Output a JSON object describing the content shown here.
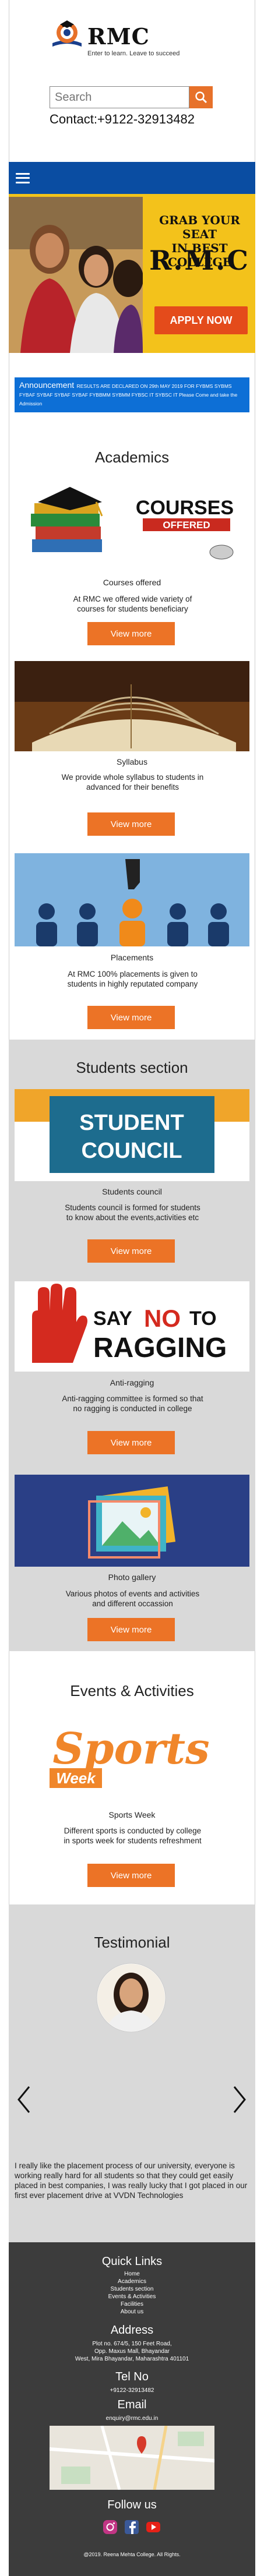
{
  "header": {
    "brand": "RMC",
    "tagline": "Enter to learn. Leave to succeed",
    "search_placeholder": "Search",
    "contact": "Contact:+9122-32913482"
  },
  "banner": {
    "line1": "GRAB YOUR SEAT",
    "line2": "IN BEST COLLEGE",
    "name": "R.M.C",
    "apply": "APPLY NOW"
  },
  "announcement": {
    "label": "Announcement",
    "text": "RESULTS ARE DECLARED ON 29th MAY 2019 FOR FYBMS SYBMS FYBAF SYBAF SYBAF SYBAF FYBBMM SYBMM FYBSC IT SYBSC IT Please Come and take the Admission"
  },
  "academics": {
    "title": "Academics",
    "items": [
      {
        "image_label": "COURSES OFFERED",
        "caption": "Courses offered",
        "desc": "At RMC we offered wide variety of courses for students beneficiary",
        "button": "View more"
      },
      {
        "caption": "Syllabus",
        "desc": "We provide whole syllabus to students in advanced for their benefits",
        "button": "View more"
      },
      {
        "caption": "Placements",
        "desc": "At RMC 100% placements is given to students in highly reputated company",
        "button": "View more"
      }
    ]
  },
  "students": {
    "title": "Students section",
    "items": [
      {
        "image_label": "STUDENT COUNCIL",
        "caption": "Students council",
        "desc": "Students council is formed for students to know about the events,activities etc",
        "button": "View more"
      },
      {
        "image_label1": "SAY",
        "image_label2": "NO",
        "image_label3": "TO",
        "image_label4": "RAGGING",
        "caption": "Anti-ragging",
        "desc": "Anti-ragging committee is formed so that no ragging is conducted in college",
        "button": "View more"
      },
      {
        "caption": "Photo gallery",
        "desc": "Various photos of events and activities and different occassion",
        "button": "View more"
      }
    ]
  },
  "events": {
    "title": "Events & Activities",
    "image_label1": "Sports",
    "image_label2": "Week",
    "caption": "Sports Week",
    "desc": "Different sports is conducted by college in sports week for students refreshment",
    "button": "View more"
  },
  "testimonial": {
    "title": "Testimonial",
    "quote": "I really like the placement process of our university, everyone is working really hard for all students so that they could get easily placed in best companies, I was really lucky that I got placed in our first ever placement drive at VVDN  Technologies"
  },
  "footer": {
    "quick_links_title": "Quick Links",
    "links": [
      "Home",
      "Academics",
      "Students section",
      "Events & Activities",
      "Facilities",
      "About us"
    ],
    "address_title": "Address",
    "address_lines": [
      "Plot no. 674/5, 150 Feet Road,",
      "Opp. Maxus Mall, Bhayandar",
      "West, Mira Bhayandar, Maharashtra 401101"
    ],
    "tel_title": "Tel No",
    "tel": "+9122-32913482",
    "email_title": "Email",
    "email": "enquiry@rmc.edu.in",
    "follow_title": "Follow us",
    "copyright": "@2019. Reena Mehta College. All Rights."
  },
  "colors": {
    "nav": "#0a4da2",
    "accent": "#ec7326",
    "announcement": "#0d6fd6",
    "banner": "#f3c21b",
    "footer": "#3c3c3c"
  }
}
